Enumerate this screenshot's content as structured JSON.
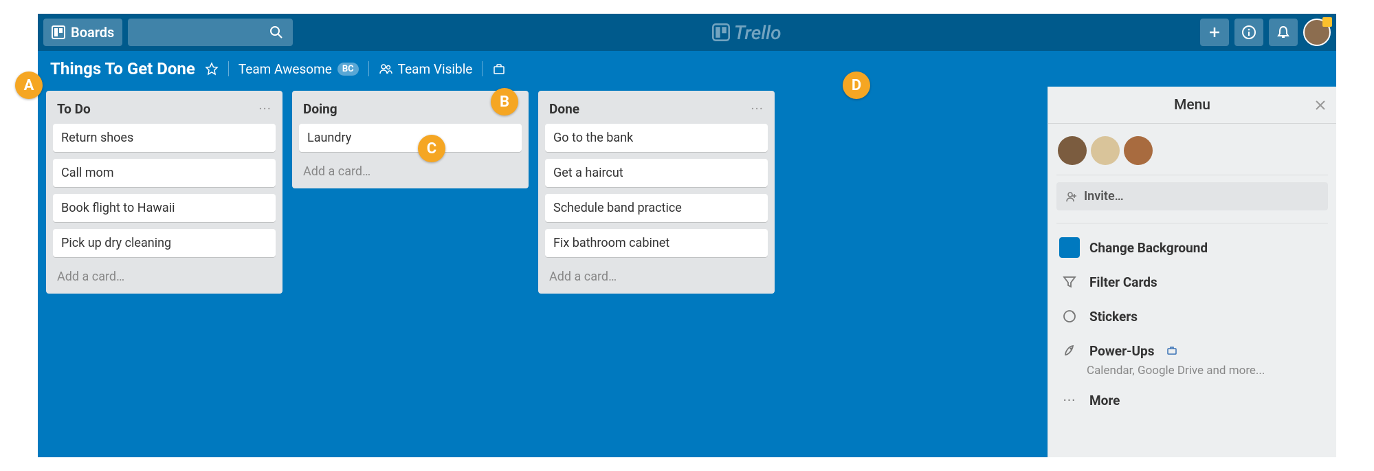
{
  "topbar": {
    "boards_label": "Boards",
    "logo": "Trello"
  },
  "board": {
    "title": "Things To Get Done",
    "team": "Team Awesome",
    "team_badge": "BC",
    "visibility": "Team Visible"
  },
  "lists": [
    {
      "title": "To Do",
      "cards": [
        "Return shoes",
        "Call mom",
        "Book flight to Hawaii",
        "Pick up dry cleaning"
      ],
      "add": "Add a card…"
    },
    {
      "title": "Doing",
      "cards": [
        "Laundry"
      ],
      "add": "Add a card…"
    },
    {
      "title": "Done",
      "cards": [
        "Go to the bank",
        "Get a haircut",
        "Schedule band practice",
        "Fix bathroom cabinet"
      ],
      "add": "Add a card…"
    }
  ],
  "menu": {
    "title": "Menu",
    "invite": "Invite…",
    "items": {
      "change_bg": "Change Background",
      "filter": "Filter Cards",
      "stickers": "Stickers",
      "powerups": "Power-Ups",
      "powerups_sub": "Calendar, Google Drive and more...",
      "more": "More"
    }
  },
  "annotations": {
    "a": "A",
    "b": "B",
    "c": "C",
    "d": "D"
  }
}
